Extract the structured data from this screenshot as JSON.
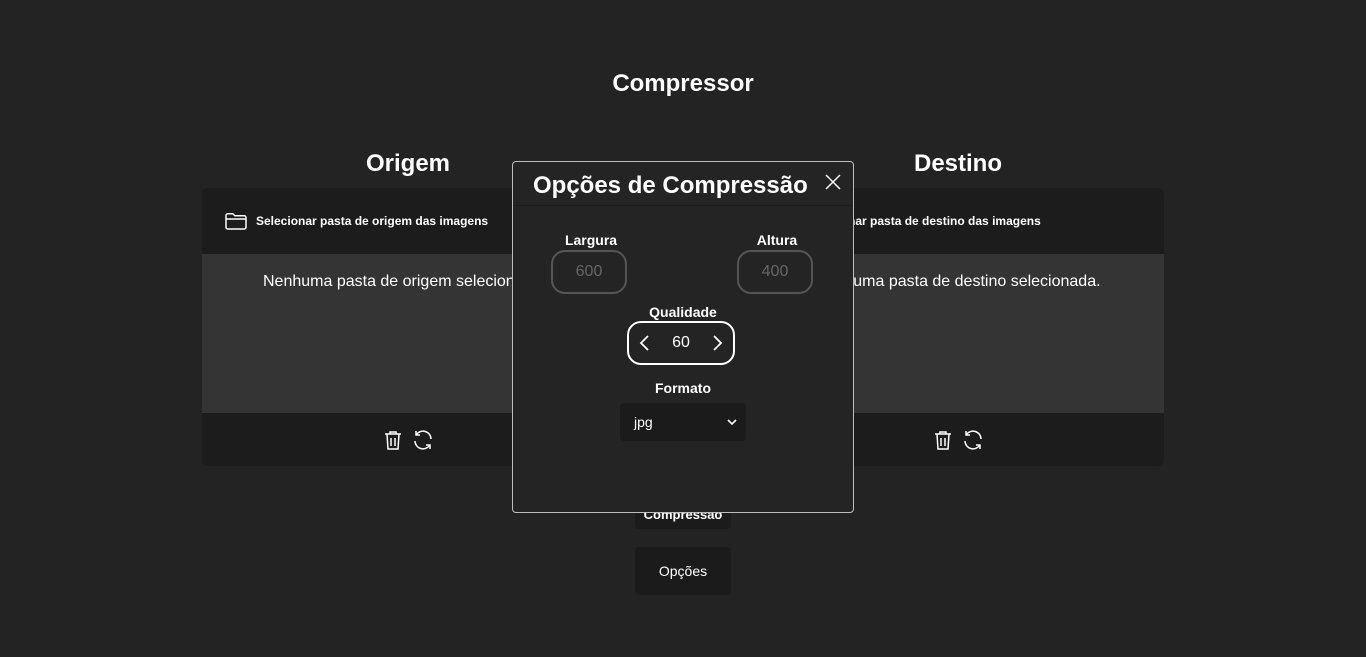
{
  "app": {
    "title": "Compressor"
  },
  "origin": {
    "heading": "Origem",
    "select_label": "Selecionar pasta de origem das imagens",
    "empty_message": "Nenhuma pasta de origem selecionada."
  },
  "destination": {
    "heading": "Destino",
    "select_label": "Selecionar pasta de destino das imagens",
    "empty_message": "Nenhuma pasta de destino selecionada."
  },
  "actions": {
    "start_label": "Iniciar Compressão",
    "options_label": "Opções"
  },
  "modal": {
    "title": "Opções de Compressão",
    "width": {
      "label": "Largura",
      "placeholder": "600"
    },
    "height": {
      "label": "Altura",
      "placeholder": "400"
    },
    "quality": {
      "label": "Qualidade",
      "value": "60"
    },
    "format": {
      "label": "Formato",
      "selected": "jpg"
    }
  },
  "icons": [
    "folder-icon",
    "trash-icon",
    "refresh-icon",
    "close-icon",
    "chevron-left-icon",
    "chevron-right-icon",
    "chevron-down-icon"
  ]
}
